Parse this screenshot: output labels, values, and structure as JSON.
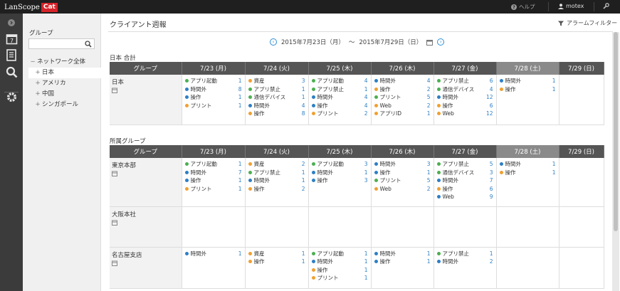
{
  "app": {
    "logo_text": "LanScope",
    "logo_badge": "Cat",
    "help": "ヘルプ",
    "user": "motex"
  },
  "colors": {
    "green": "#4caf50",
    "blue": "#2d7fc5",
    "orange": "#f0a030"
  },
  "sidebar": {
    "group_title": "グループ",
    "search_placeholder": "",
    "tree": [
      {
        "label": "ネットワーク全体",
        "prefix": "−",
        "child": false
      },
      {
        "label": "日本",
        "prefix": "+",
        "child": true,
        "selected": true
      },
      {
        "label": "アメリカ",
        "prefix": "+",
        "child": true
      },
      {
        "label": "中国",
        "prefix": "+",
        "child": true
      },
      {
        "label": "シンガポール",
        "prefix": "+",
        "child": true
      }
    ]
  },
  "main": {
    "title": "クライアント週報",
    "alarm_filter": "アラームフィルター",
    "date_from": "2015年7月23日（月）",
    "tilde": "〜",
    "date_to": "2015年7月29日（日）"
  },
  "sections": [
    {
      "title": "日本 合計",
      "header": [
        "グループ",
        "7/23 (月)",
        "7/24 (火)",
        "7/25 (木)",
        "7/26 (木)",
        "7/27 (金)",
        "7/28 (土)",
        "7/29 (日)"
      ],
      "rows": [
        {
          "name": "日本",
          "height": 70,
          "days": [
            [
              [
                "g",
                "アプリ起動",
                "1"
              ],
              [
                "b",
                "時間外",
                "8"
              ],
              [
                "b",
                "操作",
                "1"
              ],
              [
                "o",
                "プリント",
                "1"
              ]
            ],
            [
              [
                "o",
                "資産",
                "3"
              ],
              [
                "g",
                "アプリ禁止",
                "1"
              ],
              [
                "g",
                "通信デバイス",
                "1"
              ],
              [
                "b",
                "時間外",
                "4"
              ],
              [
                "o",
                "操作",
                "8"
              ]
            ],
            [
              [
                "g",
                "アプリ起動",
                "4"
              ],
              [
                "g",
                "アプリ禁止",
                "1"
              ],
              [
                "b",
                "時間外",
                "4"
              ],
              [
                "b",
                "操作",
                "4"
              ],
              [
                "o",
                "プリント",
                "2"
              ]
            ],
            [
              [
                "b",
                "時間外",
                "4"
              ],
              [
                "o",
                "操作",
                "2"
              ],
              [
                "g",
                "プリント",
                "5"
              ],
              [
                "o",
                "Web",
                "2"
              ],
              [
                "o",
                "アプリID",
                "1"
              ]
            ],
            [
              [
                "g",
                "アプリ禁止",
                "6"
              ],
              [
                "g",
                "通信デバイス",
                "4"
              ],
              [
                "b",
                "時間外",
                "12"
              ],
              [
                "o",
                "操作",
                "6"
              ],
              [
                "o",
                "Web",
                "12"
              ]
            ],
            [
              [
                "b",
                "時間外",
                "1"
              ],
              [
                "o",
                "操作",
                "1"
              ]
            ],
            []
          ]
        }
      ]
    },
    {
      "title": "所属グループ",
      "header": [
        "グループ",
        "7/23 (月)",
        "7/24 (火)",
        "7/25 (木)",
        "7/26 (木)",
        "7/27 (金)",
        "7/28 (土)",
        "7/29 (日)"
      ],
      "rows": [
        {
          "name": "東京本部",
          "height": 68,
          "days": [
            [
              [
                "g",
                "アプリ起動",
                "1"
              ],
              [
                "b",
                "時間外",
                "7"
              ],
              [
                "b",
                "操作",
                "1"
              ],
              [
                "o",
                "プリント",
                "1"
              ]
            ],
            [
              [
                "o",
                "資産",
                "2"
              ],
              [
                "g",
                "アプリ禁止",
                "1"
              ],
              [
                "b",
                "時間外",
                "1"
              ],
              [
                "o",
                "操作",
                "2"
              ]
            ],
            [
              [
                "g",
                "アプリ起動",
                "3"
              ],
              [
                "b",
                "時間外",
                "1"
              ],
              [
                "b",
                "操作",
                "3"
              ]
            ],
            [
              [
                "b",
                "時間外",
                "3"
              ],
              [
                "b",
                "操作",
                "1"
              ],
              [
                "g",
                "プリント",
                "5"
              ],
              [
                "o",
                "Web",
                "2"
              ]
            ],
            [
              [
                "g",
                "アプリ禁止",
                "5"
              ],
              [
                "g",
                "通信デバイス",
                "3"
              ],
              [
                "b",
                "時間外",
                "7"
              ],
              [
                "o",
                "操作",
                "6"
              ],
              [
                "b",
                "Web",
                "9"
              ]
            ],
            [
              [
                "b",
                "時間外",
                "1"
              ],
              [
                "o",
                "操作",
                "1"
              ]
            ],
            []
          ]
        },
        {
          "name": "大阪本社",
          "height": 57,
          "days": [
            [],
            [],
            [],
            [],
            [],
            [],
            []
          ]
        },
        {
          "name": "名古屋支店",
          "height": 58,
          "days": [
            [
              [
                "b",
                "時間外",
                "1"
              ]
            ],
            [
              [
                "o",
                "資産",
                "1"
              ],
              [
                "o",
                "操作",
                "1"
              ]
            ],
            [
              [
                "g",
                "アプリ起動",
                "1"
              ],
              [
                "b",
                "時間外",
                "1"
              ],
              [
                "o",
                "操作",
                "1"
              ],
              [
                "o",
                "プリント",
                "1"
              ]
            ],
            [
              [
                "b",
                "時間外",
                "1"
              ],
              [
                "b",
                "操作",
                "1"
              ]
            ],
            [
              [
                "g",
                "アプリ禁止",
                "1"
              ],
              [
                "b",
                "時間外",
                "2"
              ]
            ],
            [],
            []
          ]
        }
      ]
    }
  ]
}
